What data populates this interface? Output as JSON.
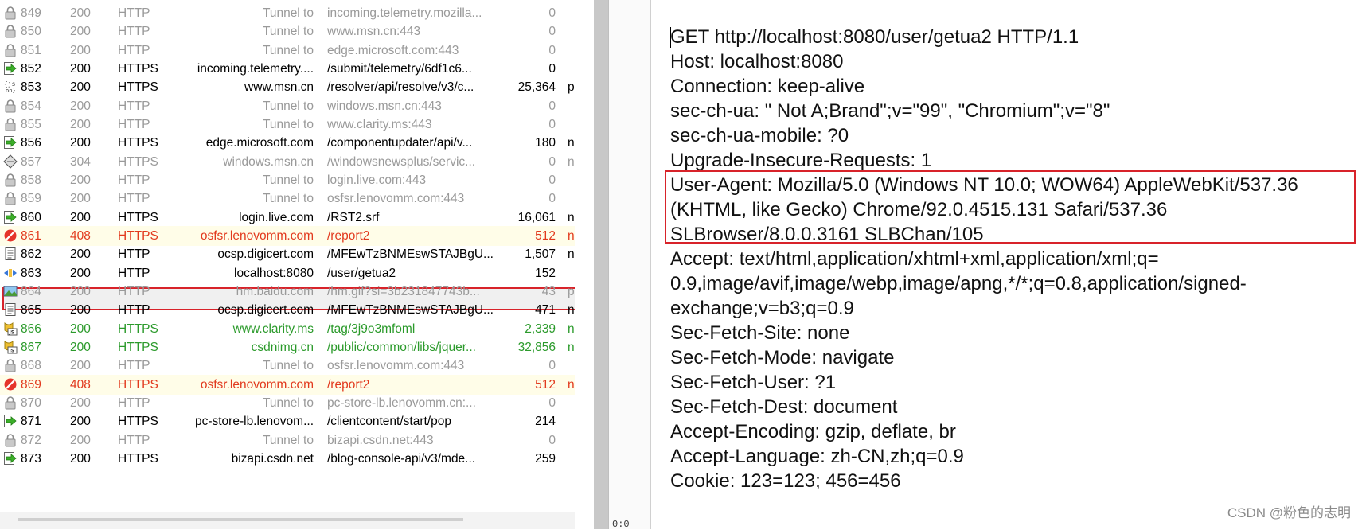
{
  "sessions": [
    {
      "num": "849",
      "result": "200",
      "protocol": "HTTP",
      "host": "Tunnel to",
      "url": "incoming.telemetry.mozilla...",
      "body": "0",
      "extra": "",
      "style": "tunnel",
      "icon": "lock-icon"
    },
    {
      "num": "850",
      "result": "200",
      "protocol": "HTTP",
      "host": "Tunnel to",
      "url": "www.msn.cn:443",
      "body": "0",
      "extra": "",
      "style": "tunnel",
      "icon": "lock-icon"
    },
    {
      "num": "851",
      "result": "200",
      "protocol": "HTTP",
      "host": "Tunnel to",
      "url": "edge.microsoft.com:443",
      "body": "0",
      "extra": "",
      "style": "tunnel",
      "icon": "lock-icon"
    },
    {
      "num": "852",
      "result": "200",
      "protocol": "HTTPS",
      "host": "incoming.telemetry....",
      "url": "/submit/telemetry/6df1c6...",
      "body": "0",
      "extra": "",
      "style": "normal",
      "icon": "arrow-icon"
    },
    {
      "num": "853",
      "result": "200",
      "protocol": "HTTPS",
      "host": "www.msn.cn",
      "url": "/resolver/api/resolve/v3/c...",
      "body": "25,364",
      "extra": "p",
      "style": "normal",
      "icon": "json-icon"
    },
    {
      "num": "854",
      "result": "200",
      "protocol": "HTTP",
      "host": "Tunnel to",
      "url": "windows.msn.cn:443",
      "body": "0",
      "extra": "",
      "style": "tunnel",
      "icon": "lock-icon"
    },
    {
      "num": "855",
      "result": "200",
      "protocol": "HTTP",
      "host": "Tunnel to",
      "url": "www.clarity.ms:443",
      "body": "0",
      "extra": "",
      "style": "tunnel",
      "icon": "lock-icon"
    },
    {
      "num": "856",
      "result": "200",
      "protocol": "HTTPS",
      "host": "edge.microsoft.com",
      "url": "/componentupdater/api/v...",
      "body": "180",
      "extra": "n",
      "style": "normal",
      "icon": "arrow-icon"
    },
    {
      "num": "857",
      "result": "304",
      "protocol": "HTTPS",
      "host": "windows.msn.cn",
      "url": "/windowsnewsplus/servic...",
      "body": "0",
      "extra": "n",
      "style": "muted",
      "icon": "diamond-icon"
    },
    {
      "num": "858",
      "result": "200",
      "protocol": "HTTP",
      "host": "Tunnel to",
      "url": "login.live.com:443",
      "body": "0",
      "extra": "",
      "style": "tunnel",
      "icon": "lock-icon"
    },
    {
      "num": "859",
      "result": "200",
      "protocol": "HTTP",
      "host": "Tunnel to",
      "url": "osfsr.lenovomm.com:443",
      "body": "0",
      "extra": "",
      "style": "tunnel",
      "icon": "lock-icon"
    },
    {
      "num": "860",
      "result": "200",
      "protocol": "HTTPS",
      "host": "login.live.com",
      "url": "/RST2.srf",
      "body": "16,061",
      "extra": "n",
      "style": "normal",
      "icon": "arrow-icon"
    },
    {
      "num": "861",
      "result": "408",
      "protocol": "HTTPS",
      "host": "osfsr.lenovomm.com",
      "url": "/report2",
      "body": "512",
      "extra": "n",
      "style": "error",
      "icon": "blocked-icon"
    },
    {
      "num": "862",
      "result": "200",
      "protocol": "HTTP",
      "host": "ocsp.digicert.com",
      "url": "/MFEwTzBNMEswSTAJBgU...",
      "body": "1,507",
      "extra": "n",
      "style": "normal",
      "icon": "document-icon"
    },
    {
      "num": "863",
      "result": "200",
      "protocol": "HTTP",
      "host": "localhost:8080",
      "url": "/user/getua2",
      "body": "152",
      "extra": "",
      "style": "normal",
      "icon": "html-icon"
    },
    {
      "num": "864",
      "result": "200",
      "protocol": "HTTP",
      "host": "hm.baidu.com",
      "url": "/hm.gif?si=3b231847743b...",
      "body": "43",
      "extra": "p",
      "style": "muted",
      "icon": "image-icon"
    },
    {
      "num": "865",
      "result": "200",
      "protocol": "HTTP",
      "host": "ocsp.digicert.com",
      "url": "/MFEwTzBNMEswSTAJBgU...",
      "body": "471",
      "extra": "n",
      "style": "normal",
      "icon": "document-icon"
    },
    {
      "num": "866",
      "result": "200",
      "protocol": "HTTPS",
      "host": "www.clarity.ms",
      "url": "/tag/3j9o3mfoml",
      "body": "2,339",
      "extra": "n",
      "style": "js",
      "icon": "js-icon"
    },
    {
      "num": "867",
      "result": "200",
      "protocol": "HTTPS",
      "host": "csdnimg.cn",
      "url": "/public/common/libs/jquer...",
      "body": "32,856",
      "extra": "n",
      "style": "js",
      "icon": "js-icon"
    },
    {
      "num": "868",
      "result": "200",
      "protocol": "HTTP",
      "host": "Tunnel to",
      "url": "osfsr.lenovomm.com:443",
      "body": "0",
      "extra": "",
      "style": "tunnel",
      "icon": "lock-icon"
    },
    {
      "num": "869",
      "result": "408",
      "protocol": "HTTPS",
      "host": "osfsr.lenovomm.com",
      "url": "/report2",
      "body": "512",
      "extra": "n",
      "style": "error",
      "icon": "blocked-icon"
    },
    {
      "num": "870",
      "result": "200",
      "protocol": "HTTP",
      "host": "Tunnel to",
      "url": "pc-store-lb.lenovomm.cn:...",
      "body": "0",
      "extra": "",
      "style": "tunnel",
      "icon": "lock-icon"
    },
    {
      "num": "871",
      "result": "200",
      "protocol": "HTTPS",
      "host": "pc-store-lb.lenovom...",
      "url": "/clientcontent/start/pop",
      "body": "214",
      "extra": "",
      "style": "normal",
      "icon": "arrow-icon"
    },
    {
      "num": "872",
      "result": "200",
      "protocol": "HTTP",
      "host": "Tunnel to",
      "url": "bizapi.csdn.net:443",
      "body": "0",
      "extra": "",
      "style": "tunnel",
      "icon": "lock-icon"
    },
    {
      "num": "873",
      "result": "200",
      "protocol": "HTTPS",
      "host": "bizapi.csdn.net",
      "url": "/blog-console-api/v3/mde...",
      "body": "259",
      "extra": "",
      "style": "normal",
      "icon": "arrow-icon"
    }
  ],
  "selected_session": "863",
  "status": {
    "splitter_text": "0:0"
  },
  "request_lines": [
    "GET http://localhost:8080/user/getua2 HTTP/1.1",
    "Host: localhost:8080",
    "Connection: keep-alive",
    "sec-ch-ua: \" Not A;Brand\";v=\"99\", \"Chromium\";v=\"8\"",
    "sec-ch-ua-mobile: ?0",
    "Upgrade-Insecure-Requests: 1",
    "User-Agent: Mozilla/5.0 (Windows NT 10.0; WOW64) AppleWebKit/537.36",
    "(KHTML, like Gecko) Chrome/92.0.4515.131 Safari/537.36",
    "SLBrowser/8.0.0.3161 SLBChan/105",
    "Accept: text/html,application/xhtml+xml,application/xml;q=",
    "0.9,image/avif,image/webp,image/apng,*/*;q=0.8,application/signed-",
    "exchange;v=b3;q=0.9",
    "Sec-Fetch-Site: none",
    "Sec-Fetch-Mode: navigate",
    "Sec-Fetch-User: ?1",
    "Sec-Fetch-Dest: document",
    "Accept-Encoding: gzip, deflate, br",
    "Accept-Language: zh-CN,zh;q=0.9",
    "Cookie: 123=123; 456=456"
  ],
  "watermark": "CSDN @粉色的志明",
  "colors": {
    "highlight_border": "#d8232a",
    "error_text": "#e23a1e",
    "js_text": "#2b9a2b",
    "tunnel_text": "#9a9a9a"
  }
}
